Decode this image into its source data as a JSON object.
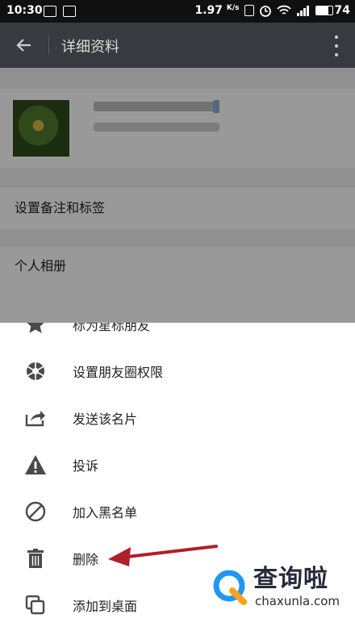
{
  "status_bar": {
    "time": "10:30",
    "speed_value": "1.97",
    "speed_unit": "K/s",
    "battery": "74"
  },
  "app_bar": {
    "title": "详细资料"
  },
  "profile": {
    "remark_row": "设置备注和标签",
    "album_row": "个人相册"
  },
  "sheet": {
    "items": [
      {
        "label": "标为星标朋友",
        "icon": "star-icon"
      },
      {
        "label": "设置朋友圈权限",
        "icon": "aperture-icon"
      },
      {
        "label": "发送该名片",
        "icon": "share-icon"
      },
      {
        "label": "投诉",
        "icon": "warning-icon"
      },
      {
        "label": "加入黑名单",
        "icon": "block-icon"
      },
      {
        "label": "删除",
        "icon": "trash-icon"
      },
      {
        "label": "添加到桌面",
        "icon": "add-to-desktop-icon"
      }
    ]
  },
  "watermark": {
    "name": "查询啦",
    "url": "chaxunla.com"
  },
  "colors": {
    "appbar": "#393a3f",
    "arrow": "#b0202a",
    "icon": "#4a4a4a"
  }
}
